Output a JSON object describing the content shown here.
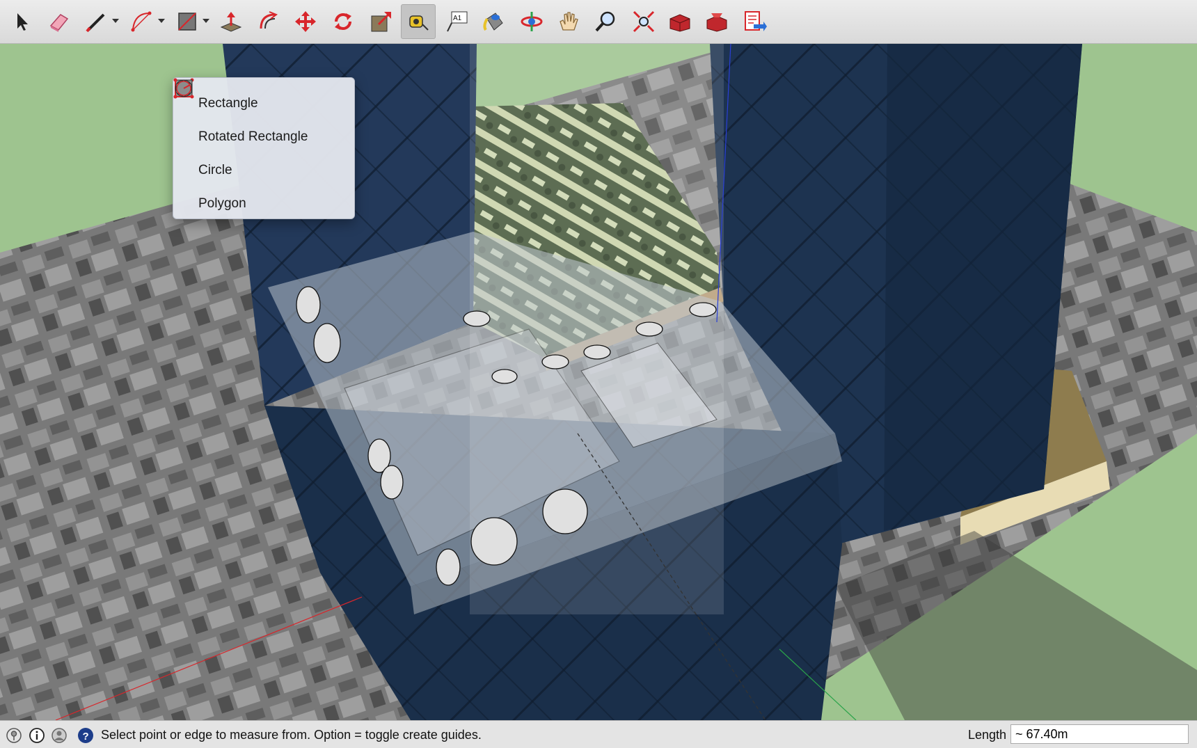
{
  "toolbar": {
    "tools": [
      {
        "name": "select-tool-icon"
      },
      {
        "name": "eraser-tool-icon"
      },
      {
        "name": "line-tool-icon"
      },
      {
        "name": "arc-tool-icon"
      },
      {
        "name": "shapes-tool-icon"
      },
      {
        "name": "push-pull-tool-icon"
      },
      {
        "name": "offset-tool-icon"
      },
      {
        "name": "move-tool-icon"
      },
      {
        "name": "rotate-tool-icon"
      },
      {
        "name": "scale-tool-icon"
      },
      {
        "name": "tape-measure-tool-icon",
        "active": true
      },
      {
        "name": "text-tool-icon",
        "text": "A1"
      },
      {
        "name": "paint-bucket-tool-icon"
      },
      {
        "name": "orbit-tool-icon"
      },
      {
        "name": "pan-tool-icon"
      },
      {
        "name": "zoom-tool-icon"
      },
      {
        "name": "zoom-extents-tool-icon"
      },
      {
        "name": "3d-warehouse-icon"
      },
      {
        "name": "extension-warehouse-icon"
      },
      {
        "name": "send-to-layout-icon"
      }
    ]
  },
  "shapes_menu": {
    "items": [
      {
        "label": "Rectangle",
        "icon": "rectangle-icon"
      },
      {
        "label": "Rotated Rectangle",
        "icon": "rotated-rectangle-icon"
      },
      {
        "label": "Circle",
        "icon": "circle-icon"
      },
      {
        "label": "Polygon",
        "icon": "polygon-icon"
      }
    ]
  },
  "status": {
    "message": "Select point or edge to measure from.  Option = toggle create guides.",
    "measurement_label": "Length",
    "measurement_value": "~ 67.40m"
  },
  "colors": {
    "ground": "#9ec48f",
    "glass": "#1e3550",
    "accent_red": "#d8262b",
    "active_tool": "#c4c4c4"
  }
}
